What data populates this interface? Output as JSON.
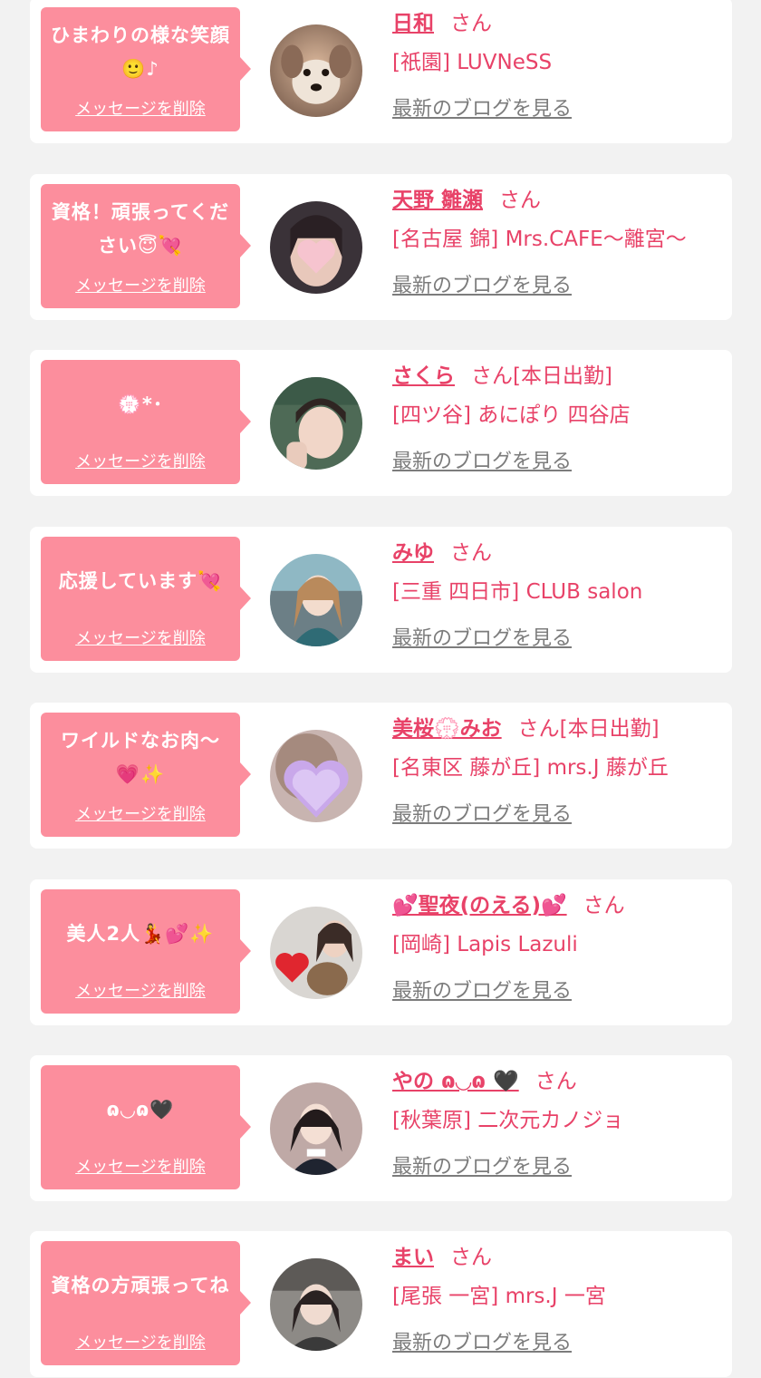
{
  "delete_label": "メッセージを削除",
  "san_label": "さん",
  "blog_label": "最新のブログを見る",
  "colors": {
    "page_bg": "#f2f2f2",
    "bubble": "#fc8e9d",
    "accent_pink": "#e84268",
    "link_gray": "#7c7c7c"
  },
  "messages": [
    {
      "message": "ひまわりの様な笑顔🙂♪",
      "name": "日和",
      "status": "",
      "shop": "[祇園] LUVNeSS",
      "avatar_icon": "dog-photo-avatar"
    },
    {
      "message": "資格！頑張ってください😇💘",
      "name": "天野 雛瀬",
      "status": "",
      "shop": "[名古屋 錦] Mrs.CAFE〜離宮〜",
      "avatar_icon": "woman-heart-mask-avatar"
    },
    {
      "message": "💮*･",
      "name": "さくら",
      "status": "[本日出勤]",
      "shop": "[四ツ谷] あにぽり 四谷店",
      "avatar_icon": "woman-photo-avatar"
    },
    {
      "message": "応援しています💘",
      "name": "みゆ",
      "status": "",
      "shop": "[三重 四日市] CLUB salon",
      "avatar_icon": "woman-photo-avatar"
    },
    {
      "message": "ワイルドなお肉〜💗✨",
      "name": "美桜💮みお",
      "status": "[本日出勤]",
      "shop": "[名東区 藤が丘] mrs.J 藤が丘",
      "avatar_icon": "purple-heart-mask-avatar"
    },
    {
      "message": "美人2人💃💕✨",
      "name": "💕聖夜(のえる)💕",
      "status": "",
      "shop": "[岡崎] Lapis Lazuli",
      "avatar_icon": "woman-with-dog-avatar"
    },
    {
      "message": "ɷ◡ɷ🖤",
      "name": "やの ɷ◡ɷ 🖤",
      "status": "",
      "shop": "[秋葉原] 二次元カノジョ",
      "avatar_icon": "woman-photo-avatar"
    },
    {
      "message": "資格の方頑張ってね",
      "name": "まい",
      "status": "",
      "shop": "[尾張 一宮] mrs.J 一宮",
      "avatar_icon": "woman-photo-avatar"
    }
  ]
}
